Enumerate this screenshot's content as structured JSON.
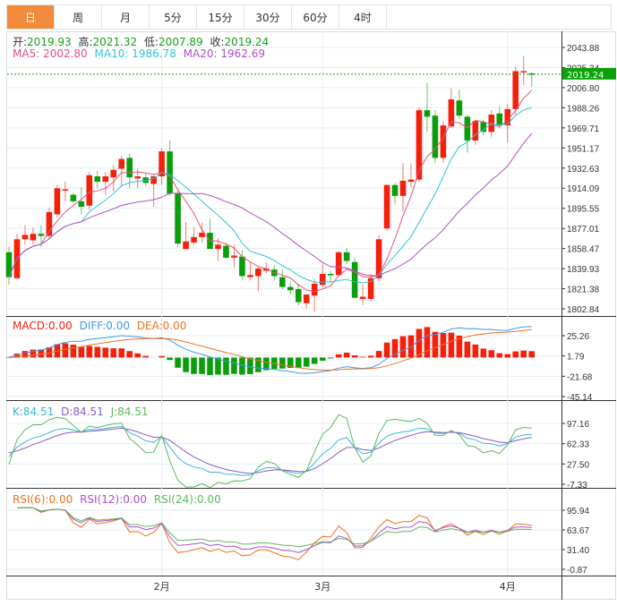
{
  "tabs": [
    "日",
    "周",
    "月",
    "5分",
    "15分",
    "30分",
    "60分",
    "4时"
  ],
  "active_tab": 0,
  "ohlc_legend": {
    "open_label": "开:",
    "open": "2019.93",
    "high_label": "高:",
    "high": "2021.32",
    "low_label": "低:",
    "low": "2007.89",
    "close_label": "收:",
    "close": "2019.24"
  },
  "ma_legend": {
    "ma5": "MA5: 2002.80",
    "ma10": "MA10: 1986.78",
    "ma20": "MA20: 1962.69"
  },
  "macd_legend": {
    "macd": "MACD:0.00",
    "diff": "DIFF:0.00",
    "dea": "DEA:0.00"
  },
  "kdj_legend": {
    "k": "K:84.51",
    "d": "D:84.51",
    "j": "J:84.51"
  },
  "rsi_legend": {
    "rsi6": "RSI(6):0.00",
    "rsi12": "RSI(12):0.00",
    "rsi24": "RSI(24):0.00"
  },
  "last_price": "2019.24",
  "colors": {
    "up": "#f5200c",
    "down": "#0a9e0a",
    "ma5": "#e8507a",
    "ma10": "#2fc4dc",
    "ma20": "#b050c8",
    "diff": "#3d9ae8",
    "dea": "#f07020",
    "k": "#39b5d6",
    "d": "#8a5cc8",
    "j": "#5cb85c",
    "rsi6": "#f07020",
    "rsi12": "#b050c8",
    "rsi24": "#5cb85c",
    "accent": "#f38b3c"
  },
  "chart_data": {
    "type": "candlestick",
    "price_ticks": [
      2043.88,
      2025.34,
      2006.8,
      1988.26,
      1969.71,
      1951.17,
      1932.63,
      1914.09,
      1895.55,
      1877.01,
      1858.47,
      1839.93,
      1821.38,
      1802.84
    ],
    "macd_ticks": [
      25.26,
      1.79,
      -21.68,
      -45.14
    ],
    "kdj_ticks": [
      97.16,
      62.33,
      27.5,
      -7.33
    ],
    "rsi_ticks": [
      95.94,
      63.67,
      31.4,
      -0.87
    ],
    "month_labels": [
      {
        "label": "2月",
        "index": 19
      },
      {
        "label": "3月",
        "index": 39
      },
      {
        "label": "4月",
        "index": 62
      }
    ],
    "candles": [
      [
        1855,
        1860,
        1825,
        1832
      ],
      [
        1831,
        1872,
        1831,
        1867
      ],
      [
        1867,
        1880,
        1862,
        1871
      ],
      [
        1866,
        1878,
        1862,
        1872
      ],
      [
        1872,
        1880,
        1860,
        1870
      ],
      [
        1870,
        1896,
        1868,
        1892
      ],
      [
        1890,
        1917,
        1887,
        1914
      ],
      [
        1912,
        1920,
        1902,
        1913
      ],
      [
        1908,
        1910,
        1900,
        1902
      ],
      [
        1902,
        1915,
        1890,
        1897
      ],
      [
        1898,
        1929,
        1894,
        1926
      ],
      [
        1925,
        1930,
        1914,
        1920
      ],
      [
        1920,
        1929,
        1908,
        1925
      ],
      [
        1924,
        1935,
        1911,
        1931
      ],
      [
        1932,
        1944,
        1916,
        1941
      ],
      [
        1942,
        1946,
        1914,
        1924
      ],
      [
        1923,
        1932,
        1914,
        1925
      ],
      [
        1924,
        1928,
        1916,
        1919
      ],
      [
        1918,
        1927,
        1897,
        1925
      ],
      [
        1925,
        1951,
        1917,
        1948
      ],
      [
        1948,
        1958,
        1907,
        1909
      ],
      [
        1909,
        1912,
        1860,
        1863
      ],
      [
        1858,
        1883,
        1858,
        1865
      ],
      [
        1864,
        1878,
        1862,
        1869
      ],
      [
        1869,
        1882,
        1864,
        1873
      ],
      [
        1873,
        1886,
        1858,
        1858
      ],
      [
        1858,
        1868,
        1847,
        1862
      ],
      [
        1861,
        1864,
        1849,
        1850
      ],
      [
        1850,
        1862,
        1841,
        1852
      ],
      [
        1851,
        1857,
        1829,
        1833
      ],
      [
        1832,
        1846,
        1829,
        1834
      ],
      [
        1833,
        1842,
        1819,
        1840
      ],
      [
        1838,
        1846,
        1836,
        1840
      ],
      [
        1839,
        1843,
        1829,
        1833
      ],
      [
        1832,
        1839,
        1821,
        1823
      ],
      [
        1823,
        1828,
        1816,
        1820
      ],
      [
        1821,
        1826,
        1806,
        1809
      ],
      [
        1808,
        1816,
        1803,
        1816
      ],
      [
        1815,
        1830,
        1800,
        1826
      ],
      [
        1825,
        1844,
        1822,
        1835
      ],
      [
        1835,
        1838,
        1828,
        1834
      ],
      [
        1834,
        1856,
        1833,
        1855
      ],
      [
        1855,
        1859,
        1844,
        1847
      ],
      [
        1846,
        1850,
        1813,
        1813
      ],
      [
        1812,
        1825,
        1806,
        1814
      ],
      [
        1812,
        1835,
        1810,
        1831
      ],
      [
        1831,
        1871,
        1828,
        1867
      ],
      [
        1877,
        1918,
        1875,
        1917
      ],
      [
        1917,
        1919,
        1899,
        1907
      ],
      [
        1907,
        1937,
        1893,
        1921
      ],
      [
        1920,
        1937,
        1915,
        1922
      ],
      [
        1922,
        1989,
        1920,
        1986
      ],
      [
        1986,
        2011,
        1966,
        1980
      ],
      [
        1981,
        1986,
        1937,
        1942
      ],
      [
        1942,
        1976,
        1938,
        1972
      ],
      [
        1971,
        2006,
        1970,
        1996
      ],
      [
        1995,
        2005,
        1978,
        1981
      ],
      [
        1980,
        1982,
        1947,
        1958
      ],
      [
        1958,
        1977,
        1954,
        1976
      ],
      [
        1975,
        1977,
        1963,
        1966
      ],
      [
        1966,
        1986,
        1961,
        1982
      ],
      [
        1983,
        1990,
        1969,
        1972
      ],
      [
        1972,
        1992,
        1956,
        1987
      ],
      [
        1987,
        2026,
        1982,
        2022
      ],
      [
        2021,
        2036,
        2009,
        2022
      ],
      [
        2019.93,
        2021.32,
        2007.89,
        2019.24
      ]
    ]
  }
}
